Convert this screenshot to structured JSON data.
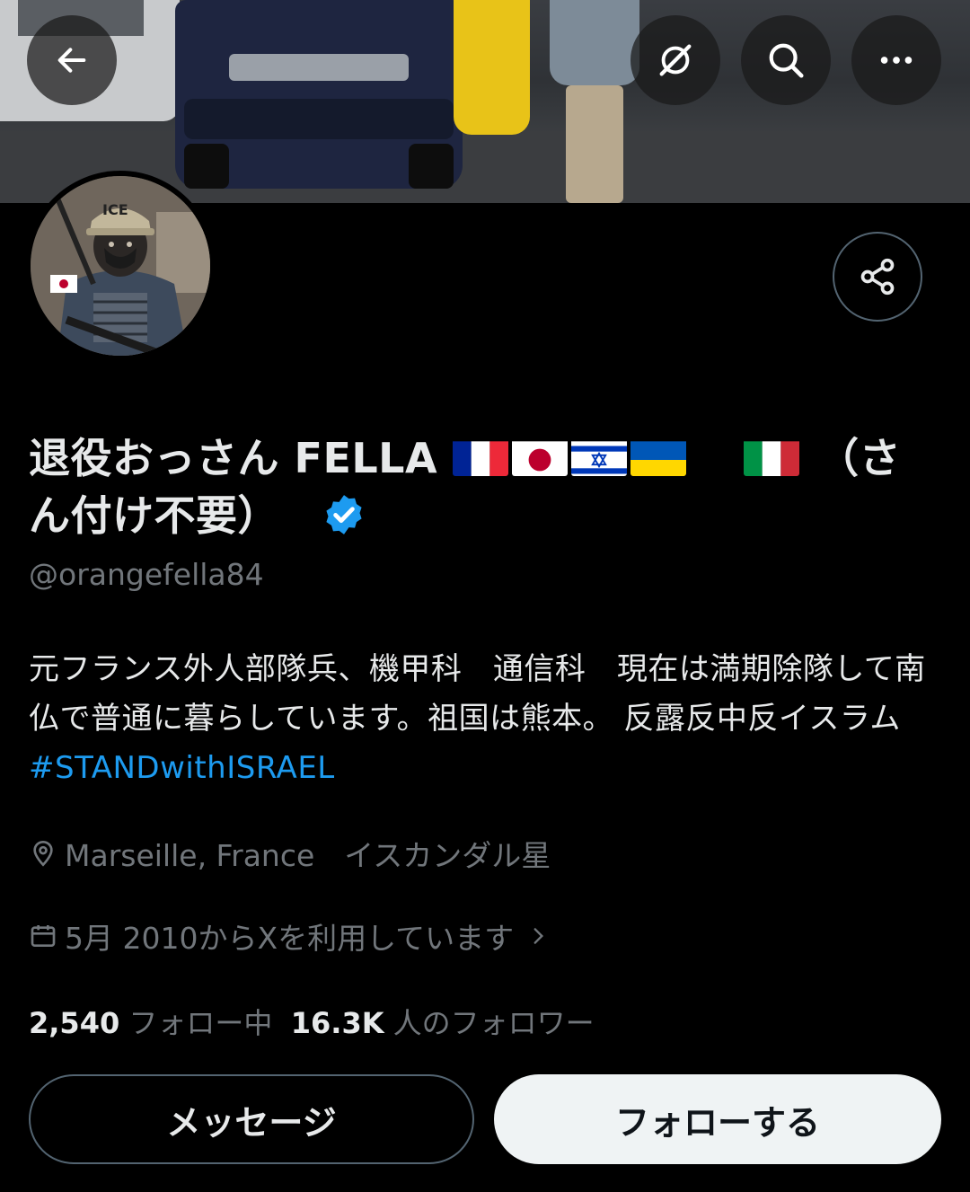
{
  "header": {
    "back_icon": "arrow-left-icon",
    "hide_icon": "eye-slash-icon",
    "search_icon": "search-icon",
    "more_icon": "more-horizontal-icon"
  },
  "profile": {
    "name_main": "退役おっさん FELLA",
    "name_suffix_1": "（さ",
    "name_suffix_2": "ん付け不要）",
    "flags": [
      "france",
      "japan",
      "israel",
      "ukraine",
      "italy"
    ],
    "verified": true,
    "handle": "@orangefella84",
    "bio_text": "元フランス外人部隊兵、機甲科　通信科　現在は満期除隊して南仏で普通に暮らしています。祖国は熊本。 反露反中反イスラム　",
    "bio_hashtag": "#STANDwithISRAEL",
    "location": "Marseille, France　イスカンダル星",
    "joined": "5月 2010からXを利用しています",
    "following_count": "2,540",
    "following_label": "フォロー中",
    "followers_count": "16.3K",
    "followers_label": "人のフォロワー"
  },
  "actions": {
    "message_label": "メッセージ",
    "follow_label": "フォローする"
  },
  "colors": {
    "background": "#000000",
    "text": "#e7e9ea",
    "secondary": "#71767b",
    "accent": "#1d9bf0",
    "follow_bg": "#eff3f4"
  }
}
